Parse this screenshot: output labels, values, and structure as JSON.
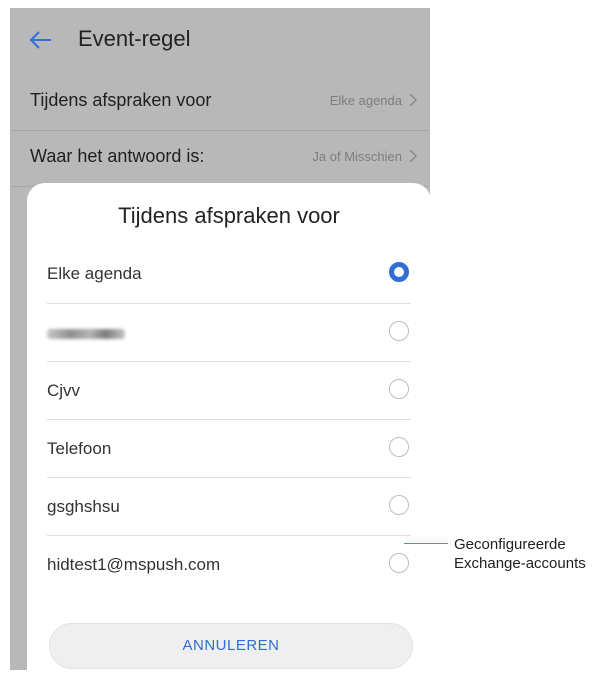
{
  "header": {
    "title": "Event-regel"
  },
  "settings": [
    {
      "label": "Tijdens afspraken voor",
      "value": "Elke agenda"
    },
    {
      "label": "Waar het antwoord is:",
      "value": "Ja of Misschien"
    }
  ],
  "dialog": {
    "title": "Tijdens afspraken voor",
    "options": [
      {
        "label": "Elke agenda",
        "selected": true
      },
      {
        "label": "",
        "selected": false
      },
      {
        "label": "Cjvv",
        "selected": false
      },
      {
        "label": "Telefoon",
        "selected": false
      },
      {
        "label": "gsghshsu",
        "selected": false
      },
      {
        "label": "hidtest1@mspush.com",
        "selected": false
      }
    ],
    "cancel_label": "ANNULEREN"
  },
  "callout": {
    "line1": "Geconfigureerde",
    "line2": "Exchange-accounts"
  },
  "colors": {
    "accent": "#2f6fd6",
    "callout_line": "#29a7c6"
  },
  "icons": {
    "back": "arrow-left-icon",
    "chevron": "chevron-right-icon",
    "radio": "radio-icon"
  }
}
